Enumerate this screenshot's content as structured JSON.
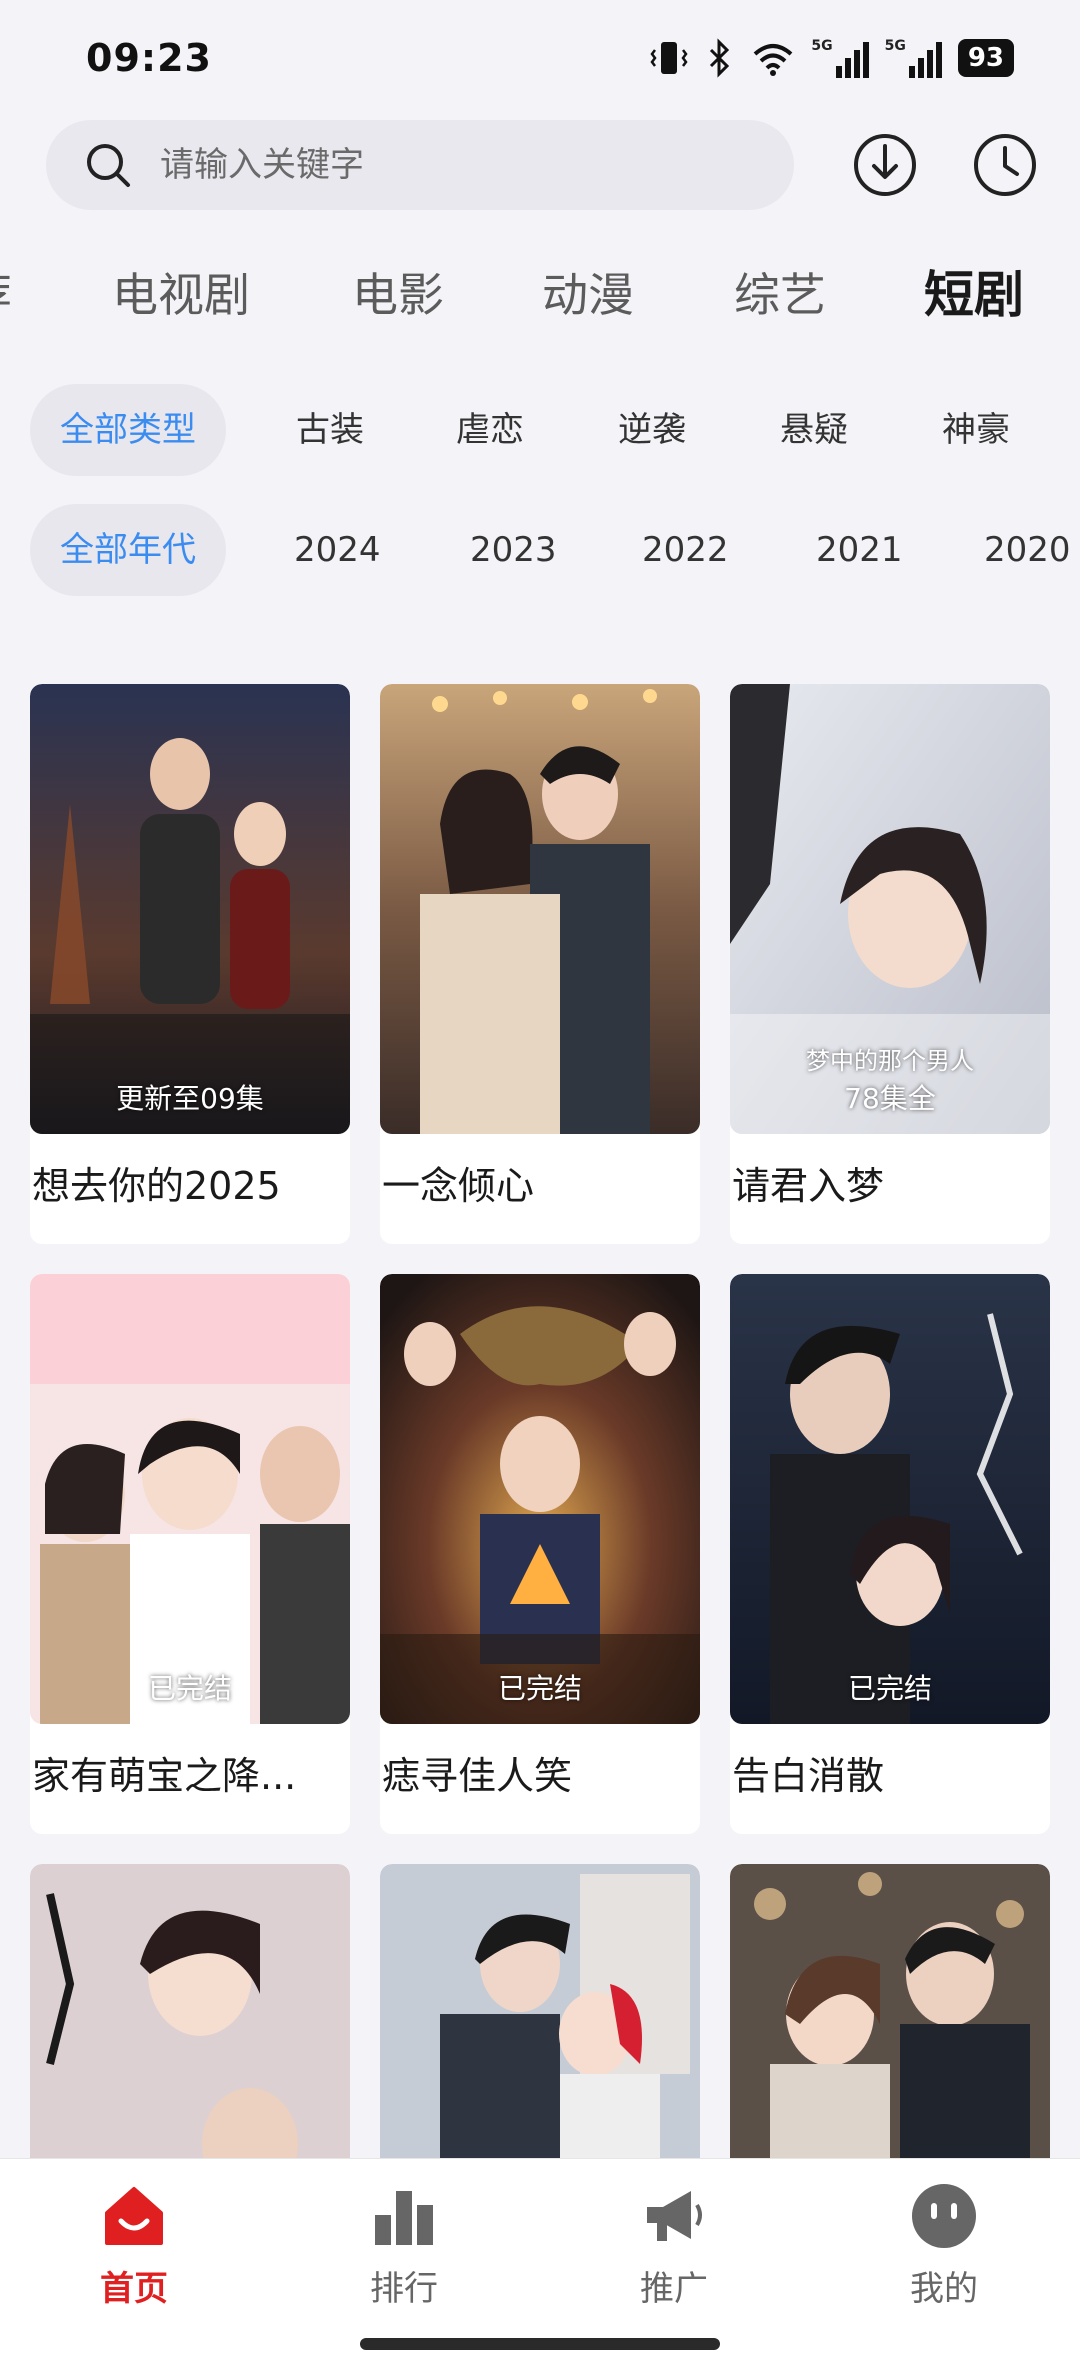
{
  "status": {
    "time": "09:23",
    "battery": "93",
    "signal_label_1": "5G",
    "signal_label_2": "5G"
  },
  "search": {
    "placeholder": "请输入关键字"
  },
  "category_tabs": [
    {
      "label": "荐"
    },
    {
      "label": "电视剧"
    },
    {
      "label": "电影"
    },
    {
      "label": "动漫"
    },
    {
      "label": "综艺"
    },
    {
      "label": "短剧",
      "active": true
    }
  ],
  "genre_filters": [
    "全部类型",
    "古装",
    "虐恋",
    "逆袭",
    "悬疑",
    "神豪"
  ],
  "year_filters": [
    "全部年代",
    "2024",
    "2023",
    "2022",
    "2021",
    "2020"
  ],
  "items": [
    {
      "title": "想去你的2025",
      "tag": "更新至09集",
      "sub": ""
    },
    {
      "title": "一念倾心",
      "tag": "",
      "sub": ""
    },
    {
      "title": "请君入梦",
      "tag": "78集全",
      "sub": "梦中的那个男人"
    },
    {
      "title": "家有萌宝之降...",
      "tag": "已完结",
      "sub": ""
    },
    {
      "title": "痣寻佳人笑",
      "tag": "已完结",
      "sub": ""
    },
    {
      "title": "告白消散",
      "tag": "已完结",
      "sub": ""
    },
    {
      "title": "",
      "tag": "",
      "sub": ""
    },
    {
      "title": "",
      "tag": "",
      "sub": ""
    },
    {
      "title": "",
      "tag": "",
      "sub": ""
    }
  ],
  "bottom_nav": [
    {
      "label": "首页",
      "icon": "home-icon",
      "active": true
    },
    {
      "label": "排行",
      "icon": "ranking-icon"
    },
    {
      "label": "推广",
      "icon": "megaphone-icon"
    },
    {
      "label": "我的",
      "icon": "profile-icon"
    }
  ],
  "colors": {
    "accent_blue": "#3b8cf0",
    "accent_red": "#e02020",
    "background": "#f4f3f8"
  }
}
